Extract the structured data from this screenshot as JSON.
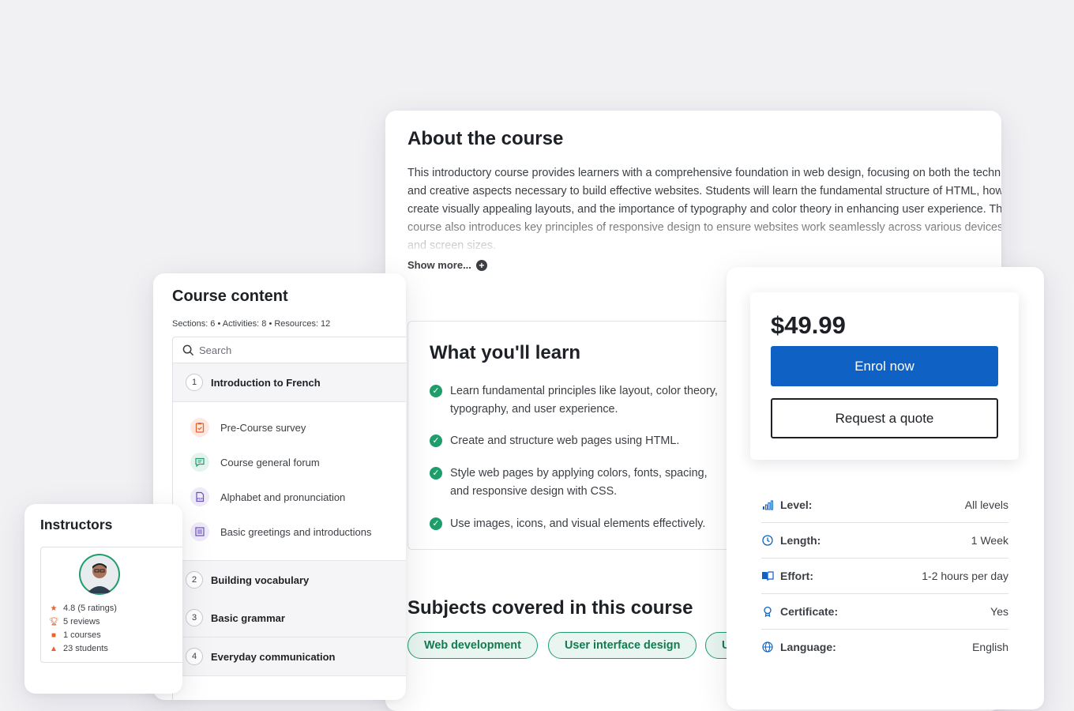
{
  "about": {
    "title": "About the course",
    "description": "This introductory course provides learners with a comprehensive foundation in web design, focusing on both the technical and creative aspects necessary to build effective websites. Students will learn the fundamental structure of HTML, how to create visually appealing layouts, and the importance of typography and color theory in enhancing user experience. The course also introduces key principles of responsive design to ensure websites work seamlessly across various devices and screen sizes.",
    "show_more": "Show more..."
  },
  "learn": {
    "title": "What you'll learn",
    "items": [
      "Learn fundamental principles like layout, color theory, typography, and user experience.",
      "Create and structure web pages using HTML.",
      "Style web pages by applying colors, fonts, spacing, and responsive design with CSS.",
      "Use images, icons, and visual elements effectively."
    ]
  },
  "subjects": {
    "title": "Subjects covered in this course",
    "pills": [
      "Web development",
      "User interface design",
      "U"
    ]
  },
  "content": {
    "title": "Course content",
    "meta": "Sections: 6  •  Activities: 8  •  Resources: 12",
    "search_placeholder": "Search",
    "sections": [
      {
        "num": "1",
        "label": "Introduction to French"
      },
      {
        "num": "2",
        "label": "Building vocabulary"
      },
      {
        "num": "3",
        "label": "Basic grammar"
      },
      {
        "num": "4",
        "label": "Everyday communication"
      }
    ],
    "activities": [
      {
        "label": "Pre-Course survey",
        "icon": "survey-icon"
      },
      {
        "label": "Course general forum",
        "icon": "forum-icon"
      },
      {
        "label": "Alphabet and pronunciation",
        "icon": "pdf-icon"
      },
      {
        "label": "Basic greetings and introductions",
        "icon": "page-icon"
      }
    ]
  },
  "instructors": {
    "title": "Instructors",
    "stats": [
      {
        "icon": "star-icon",
        "text": "4.8 (5 ratings)"
      },
      {
        "icon": "trophy-icon",
        "text": "5 reviews"
      },
      {
        "icon": "book-icon",
        "text": "1 courses"
      },
      {
        "icon": "graduation-cap-icon",
        "text": "23 students"
      }
    ]
  },
  "pricing": {
    "price": "$49.99",
    "enrol": "Enrol now",
    "quote": "Request a quote",
    "properties": [
      {
        "icon": "level-icon",
        "key": "Level:",
        "value": "All levels"
      },
      {
        "icon": "clock-icon",
        "key": "Length:",
        "value": "1 Week"
      },
      {
        "icon": "book-open-icon",
        "key": "Effort:",
        "value": "1-2 hours per day"
      },
      {
        "icon": "certificate-icon",
        "key": "Certificate:",
        "value": "Yes"
      },
      {
        "icon": "globe-icon",
        "key": "Language:",
        "value": "English"
      }
    ]
  },
  "colors": {
    "primary": "#0f61c3",
    "success": "#1f9d6b",
    "background": "#f1f1f4"
  }
}
